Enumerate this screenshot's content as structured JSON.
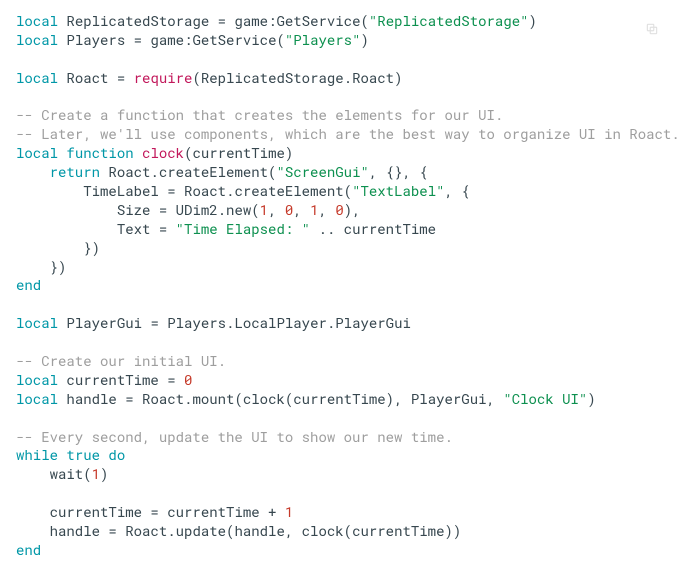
{
  "code": {
    "l1": {
      "kw": "local",
      "id": " ReplicatedStorage ",
      "op": "=",
      "call": " game:GetService(",
      "str": "\"ReplicatedStorage\"",
      "close": ")"
    },
    "l2": {
      "kw": "local",
      "id": " Players ",
      "op": "=",
      "call": " game:GetService(",
      "str": "\"Players\"",
      "close": ")"
    },
    "l4": {
      "kw": "local",
      "id": " Roact ",
      "op": "=",
      "req": " require",
      "args": "(ReplicatedStorage.Roact)"
    },
    "l6": {
      "com": "-- Create a function that creates the elements for our UI."
    },
    "l7": {
      "com": "-- Later, we'll use components, which are the best way to organize UI in Roact."
    },
    "l8": {
      "kw1": "local",
      "kw2": " function",
      "fn": " clock",
      "args": "(currentTime)"
    },
    "l9": {
      "kw": "    return",
      "call": " Roact.createElement(",
      "str": "\"ScreenGui\"",
      "rest": ", {}, {"
    },
    "l10": {
      "lead": "        TimeLabel ",
      "op": "=",
      "call": " Roact.createElement(",
      "str": "\"TextLabel\"",
      "rest": ", {"
    },
    "l11": {
      "lead": "            Size ",
      "op": "=",
      "call": " UDim2.new(",
      "n1": "1",
      "c1": ", ",
      "n2": "0",
      "c2": ", ",
      "n3": "1",
      "c3": ", ",
      "n4": "0",
      "close": "),"
    },
    "l12": {
      "lead": "            Text ",
      "op": "=",
      "str": " \"Time Elapsed: \"",
      "rest": " .. currentTime"
    },
    "l13": {
      "txt": "        })"
    },
    "l14": {
      "txt": "    })"
    },
    "l15": {
      "kw": "end"
    },
    "l17": {
      "kw": "local",
      "id": " PlayerGui ",
      "op": "=",
      "rest": " Players.LocalPlayer.PlayerGui"
    },
    "l19": {
      "com": "-- Create our initial UI."
    },
    "l20": {
      "kw": "local",
      "id": " currentTime ",
      "op": "=",
      "num": " 0"
    },
    "l21": {
      "kw": "local",
      "id": " handle ",
      "op": "=",
      "call": " Roact.mount(clock(currentTime), PlayerGui, ",
      "str": "\"Clock UI\"",
      "close": ")"
    },
    "l23": {
      "com": "-- Every second, update the UI to show our new time."
    },
    "l24": {
      "kw1": "while",
      "true": " true",
      "kw2": " do"
    },
    "l25": {
      "call": "    wait(",
      "num": "1",
      "close": ")"
    },
    "l27": {
      "lead": "    currentTime ",
      "op": "=",
      "rest": " currentTime + ",
      "num": "1"
    },
    "l28": {
      "lead": "    handle ",
      "op": "=",
      "rest": " Roact.update(handle, clock(currentTime))"
    },
    "l29": {
      "kw": "end"
    }
  }
}
